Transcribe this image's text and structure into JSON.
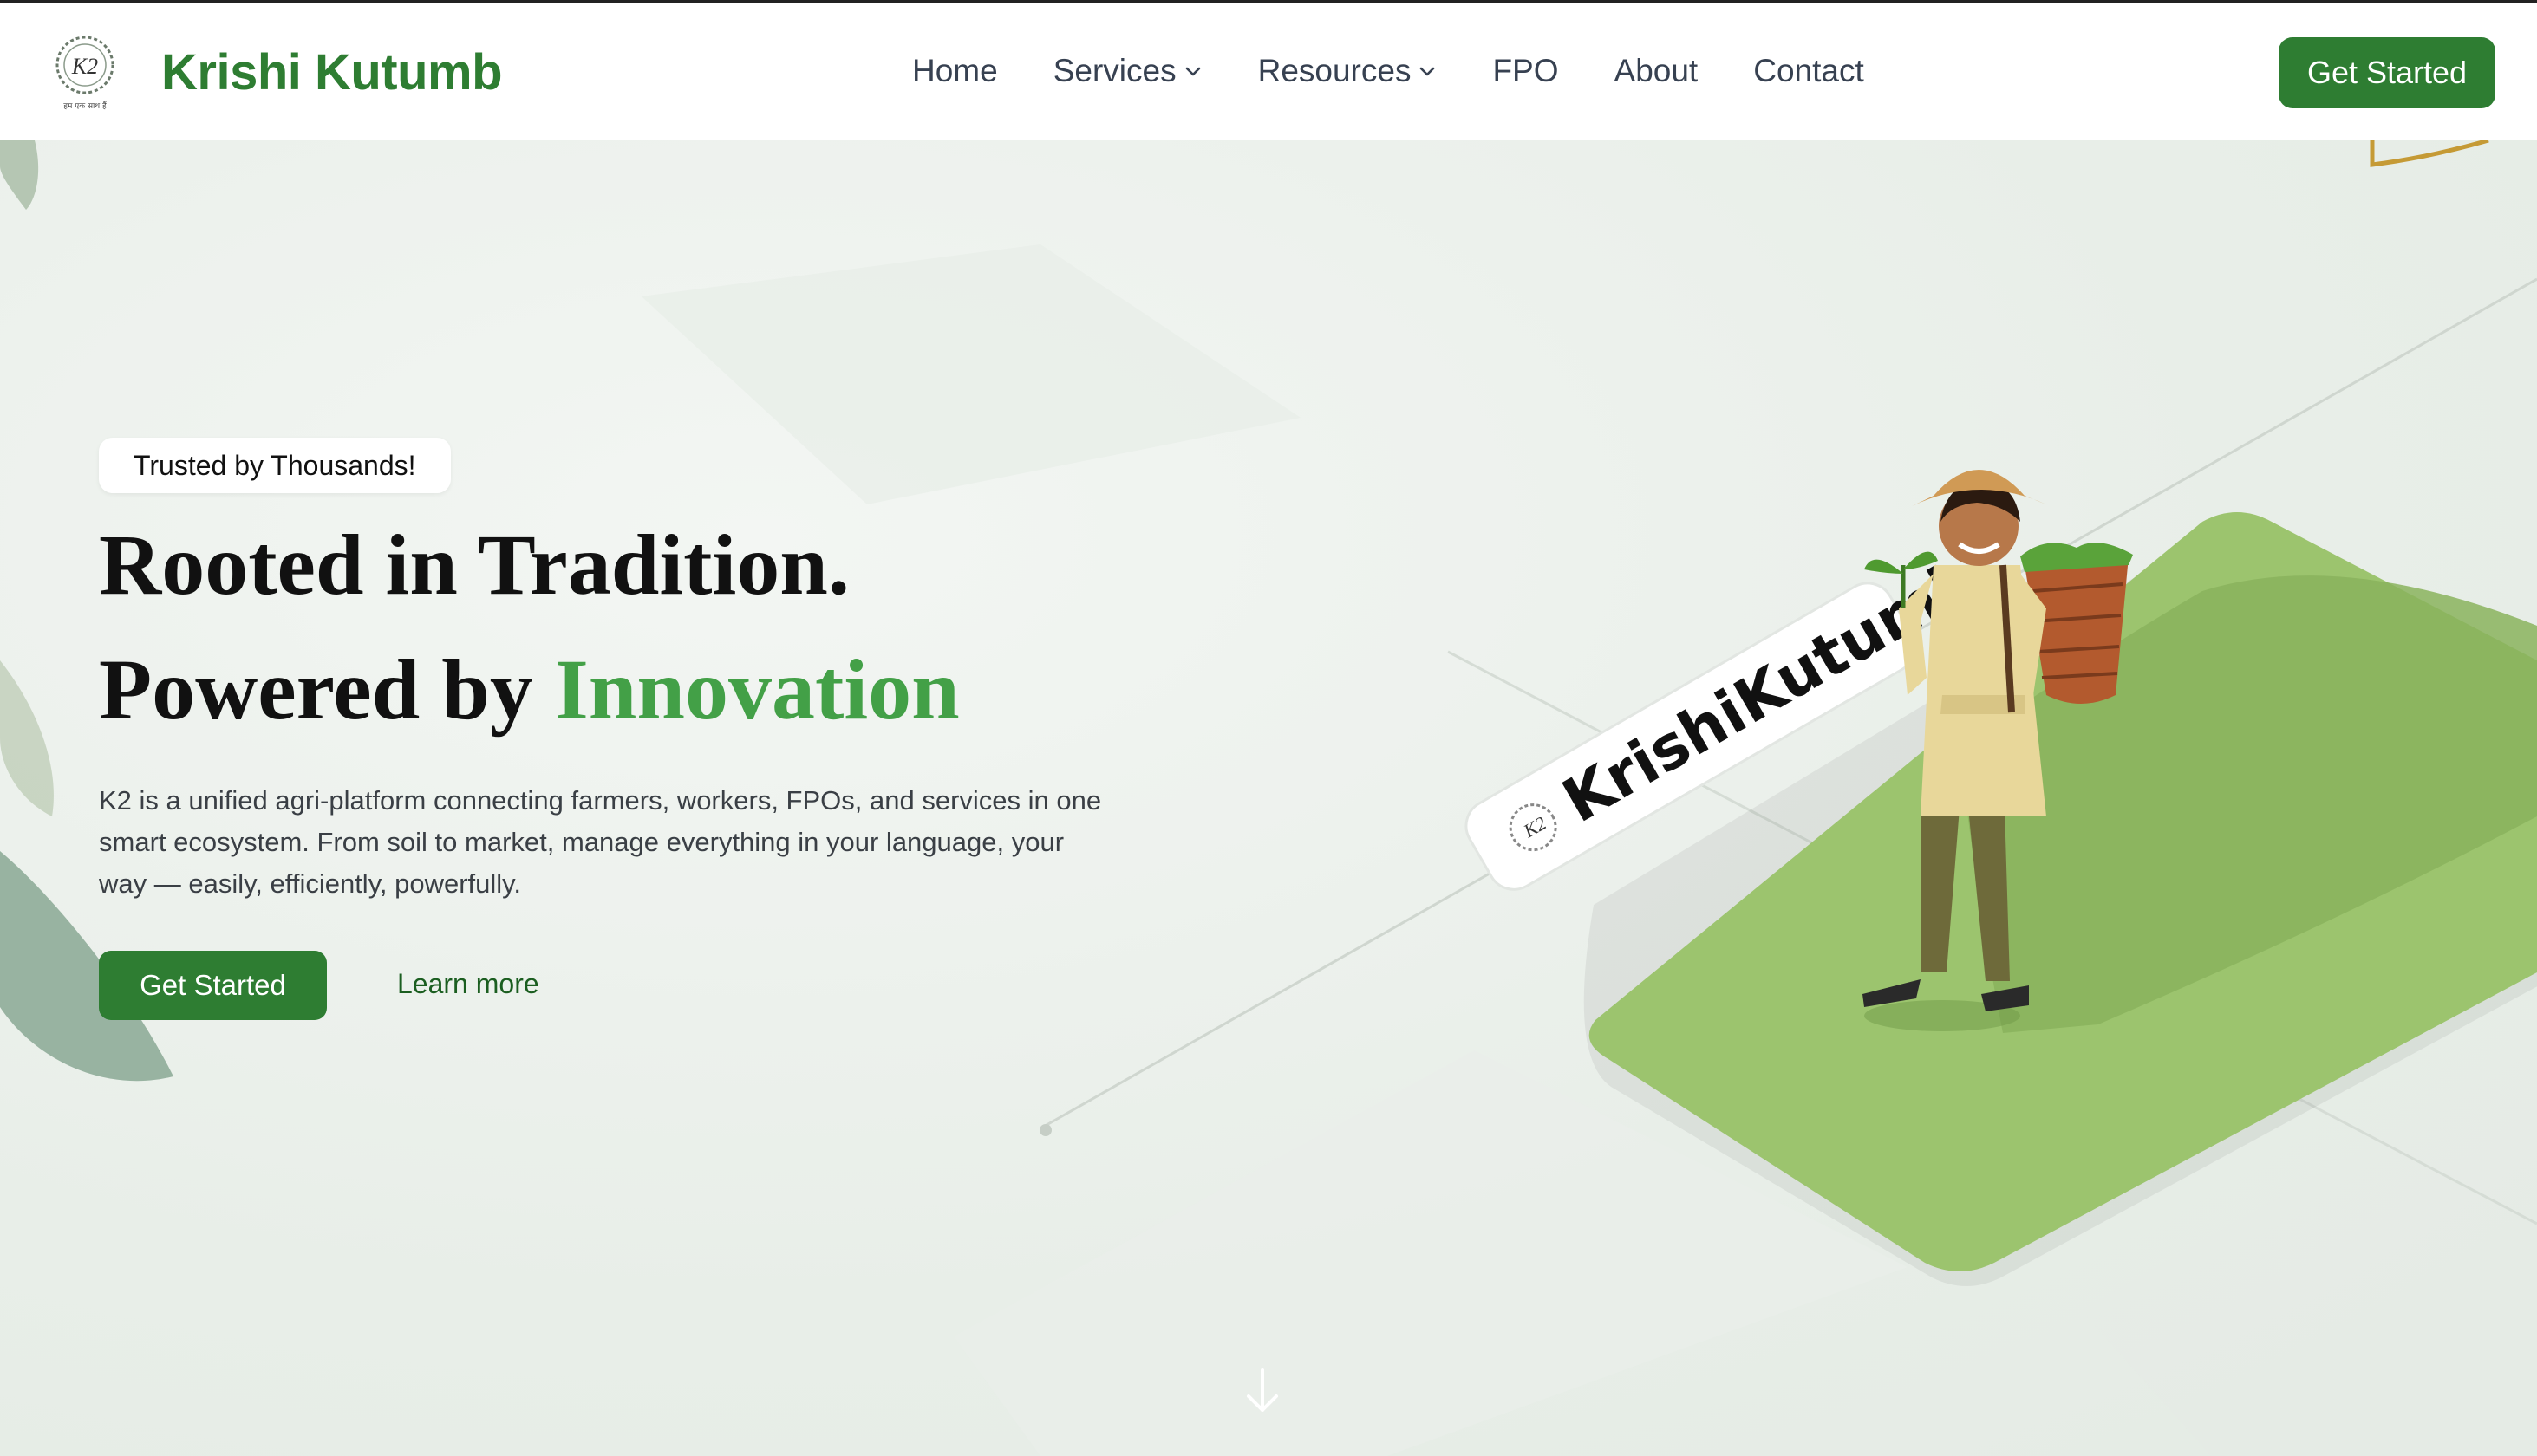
{
  "brand": {
    "name": "Krishi Kutumb",
    "logo_text": "K2",
    "logo_tagline": "हम एक साथ हैं"
  },
  "nav": {
    "items": [
      {
        "label": "Home"
      },
      {
        "label": "Services"
      },
      {
        "label": "Resources"
      },
      {
        "label": "FPO"
      },
      {
        "label": "About"
      },
      {
        "label": "Contact"
      }
    ],
    "cta": "Get Started"
  },
  "hero": {
    "badge": "Trusted by Thousands!",
    "title_line1": "Rooted in Tradition.",
    "title_line2_prefix": "Powered by ",
    "title_line2_accent": "Innovation",
    "description": "K2 is a unified agri-platform connecting farmers, workers, FPOs, and services in one smart ecosystem. From soil to market, manage everything in your language, your way — easily, efficiently, powerfully.",
    "primary_button": "Get Started",
    "secondary_link": "Learn more",
    "sign_text": "KrishiKutumb"
  },
  "colors": {
    "brand_green": "#2e7d32",
    "accent_green": "#43a047",
    "field_green": "#9cc46e"
  }
}
